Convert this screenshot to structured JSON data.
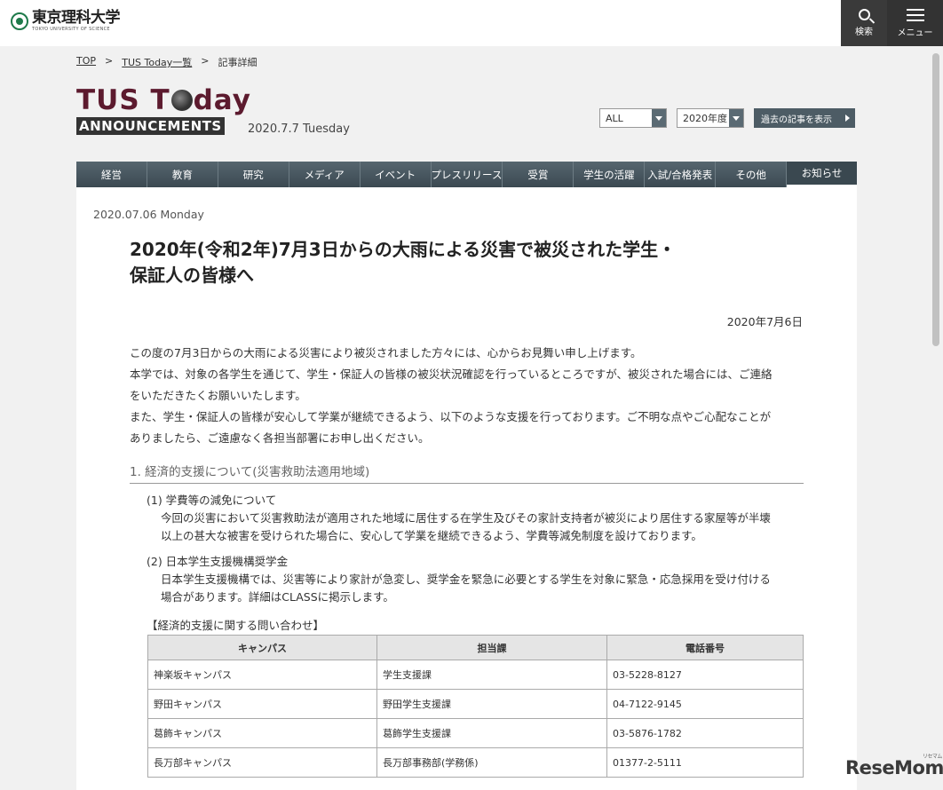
{
  "header": {
    "logo_jp": "東京理科大学",
    "logo_en": "TOKYO UNIVERSITY OF SCIENCE",
    "search_label": "検索",
    "menu_label": "メニュー"
  },
  "breadcrumb": {
    "items": [
      "TOP",
      ">",
      "TUS Today一覧",
      ">",
      "記事詳細"
    ]
  },
  "brand": {
    "title_pre": "TUS T",
    "title_post": "day",
    "subtitle": "ANNOUNCEMENTS",
    "date": "2020.7.7 Tuesday"
  },
  "filters": {
    "category": "ALL",
    "year": "2020年度",
    "past_button": "過去の記事を表示"
  },
  "nav": {
    "items": [
      "経営",
      "教育",
      "研究",
      "メディア",
      "イベント",
      "プレスリリース",
      "受賞",
      "学生の活躍",
      "入試/合格発表",
      "その他",
      "お知らせ"
    ],
    "active_index": 10
  },
  "article": {
    "post_date": "2020.07.06 Monday",
    "title_line1": "2020年(令和2年)7月3日からの大雨による災害で被災された学生・",
    "title_line2": "保証人の皆様へ",
    "pub_date": "2020年7月6日",
    "para1": "この度の7月3日からの大雨による災害により被災されました方々には、心からお見舞い申し上げます。",
    "para2a": "本学では、対象の各学生を通じて、学生・保証人の皆様の被災状況確認を行っているところですが、被災された場合には、ご連絡",
    "para2b": "をいただきたくお願いいたします。",
    "para3a": "また、学生・保証人の皆様が安心して学業が継続できるよう、以下のような支援を行っております。ご不明な点やご心配なことが",
    "para3b": "ありましたら、ご遠慮なく各担当部署にお申し出ください。",
    "section1_heading": "1. 経済的支援について(災害救助法適用地域)",
    "sub1_title": "(1) 学費等の減免について",
    "sub1_line1": "今回の災害において災害救助法が適用された地域に居住する在学生及びその家計支持者が被災により居住する家屋等が半壊",
    "sub1_line2": "以上の甚大な被害を受けられた場合に、安心して学業を継続できるよう、学費等減免制度を設けております。",
    "sub2_title": "(2) 日本学生支援機構奨学金",
    "sub2_line1": "日本学生支援機構では、災害等により家計が急変し、奨学金を緊急に必要とする学生を対象に緊急・応急採用を受け付ける",
    "sub2_line2": "場合があります。詳細はCLASSに掲示します。",
    "contact_label": "【経済的支援に関する問い合わせ】"
  },
  "contacts_table": {
    "headers": [
      "キャンパス",
      "担当課",
      "電話番号"
    ],
    "rows": [
      [
        "神楽坂キャンパス",
        "学生支援課",
        "03-5228-8127"
      ],
      [
        "野田キャンパス",
        "野田学生支援課",
        "04-7122-9145"
      ],
      [
        "葛飾キャンパス",
        "葛飾学生支援課",
        "03-5876-1782"
      ],
      [
        "長万部キャンパス",
        "長万部事務部(学務係)",
        "01377-2-5111"
      ]
    ]
  },
  "watermark": {
    "text": "ReseMom",
    "small": "リセマム"
  }
}
